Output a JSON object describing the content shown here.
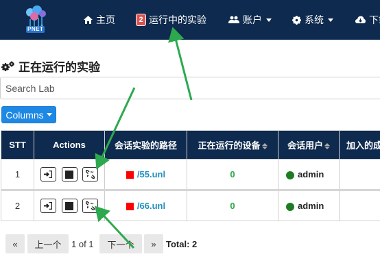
{
  "brand": {
    "logo_text": "PNET"
  },
  "nav": {
    "home_label": "主页",
    "running_badge": "2",
    "running_label": "运行中的实验",
    "accounts_label": "账户",
    "system_label": "系统",
    "download_label": "下载"
  },
  "page": {
    "title": "正在运行的实验"
  },
  "search": {
    "placeholder": "Search Lab"
  },
  "columns_button": {
    "label": "Columns"
  },
  "table": {
    "headers": [
      "STT",
      "Actions",
      "会话实验的路径",
      "正在运行的设备",
      "会话用户",
      "加入的成员"
    ],
    "rows": [
      {
        "stt": "1",
        "path": "/55.unl",
        "devices": "0",
        "user": "admin"
      },
      {
        "stt": "2",
        "path": "/66.unl",
        "devices": "0",
        "user": "admin"
      }
    ]
  },
  "pagination": {
    "first": "«",
    "prev": "上一个",
    "info": "1 of 1",
    "next": "下一个",
    "last": "»",
    "total": "Total: 2"
  },
  "colors": {
    "navbar": "#0e2a4e",
    "accent": "#1e88e5",
    "annotation_arrow": "#2ea84f",
    "lab_status": "#ff0000",
    "user_online": "#1e7d22"
  }
}
